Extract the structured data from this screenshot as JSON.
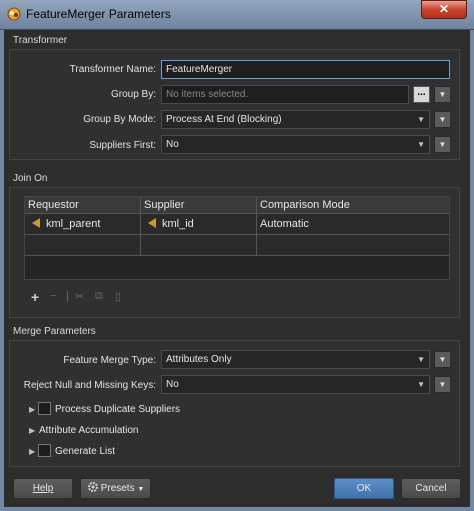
{
  "window": {
    "title": "FeatureMerger Parameters",
    "close_glyph": "✕"
  },
  "transformer": {
    "section_label": "Transformer",
    "name_label": "Transformer Name:",
    "name_value": "FeatureMerger",
    "group_by_label": "Group By:",
    "group_by_placeholder": "No items selected.",
    "group_by_button": "...",
    "group_by_mode_label": "Group By Mode:",
    "group_by_mode_value": "Process At End (Blocking)",
    "suppliers_first_label": "Suppliers First:",
    "suppliers_first_value": "No"
  },
  "join_on": {
    "section_label": "Join On",
    "columns": [
      "Requestor",
      "Supplier",
      "Comparison Mode"
    ],
    "rows": [
      {
        "requestor": "kml_parent",
        "supplier": "kml_id",
        "mode": "Automatic"
      }
    ],
    "toolbar": {
      "add": "+",
      "remove": "−",
      "sep": "|",
      "cut": "✂",
      "copy": "⧉",
      "paste": "▯"
    }
  },
  "merge": {
    "section_label": "Merge Parameters",
    "type_label": "Feature Merge Type:",
    "type_value": "Attributes Only",
    "reject_label": "Reject Null and Missing Keys:",
    "reject_value": "No",
    "process_dup_label": "Process Duplicate Suppliers",
    "attr_accum_label": "Attribute Accumulation",
    "generate_list_label": "Generate List"
  },
  "footer": {
    "help": "Help",
    "presets": "Presets",
    "ok": "OK",
    "cancel": "Cancel"
  },
  "icons": {
    "arrow_down": "▼",
    "arrow_right": "▶"
  },
  "colors": {
    "accent": "#3e73ad",
    "pin": "#c99a2e",
    "titlebar": "#7c8ea6"
  }
}
